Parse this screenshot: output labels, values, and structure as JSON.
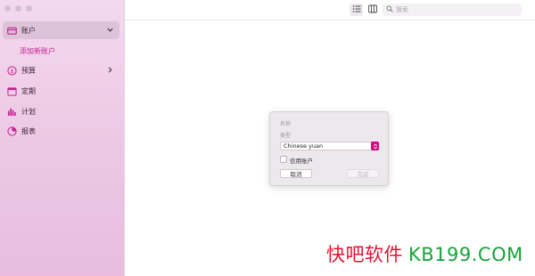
{
  "sidebar": {
    "items": [
      {
        "label": "账户",
        "icon": "wallet-icon"
      },
      {
        "label": "预算",
        "icon": "dollar-circle-icon"
      },
      {
        "label": "定期",
        "icon": "calendar-icon"
      },
      {
        "label": "计划",
        "icon": "bar-chart-icon"
      },
      {
        "label": "报表",
        "icon": "pie-chart-icon"
      }
    ],
    "sub_item": "添加新账户"
  },
  "toolbar": {
    "search_placeholder": "搜索"
  },
  "dialog": {
    "name_label": "名称",
    "type_label": "类型",
    "currency": "Chinese yuan",
    "credit_label": "信用账户",
    "cancel": "取消",
    "done": "完成"
  },
  "watermark": {
    "cn": "快吧软件",
    "en": "KB199.COM"
  },
  "colors": {
    "accent": "#e5007f",
    "sidebar_bg": "#ecc7e3",
    "sub_item_text": "#c71f92"
  }
}
